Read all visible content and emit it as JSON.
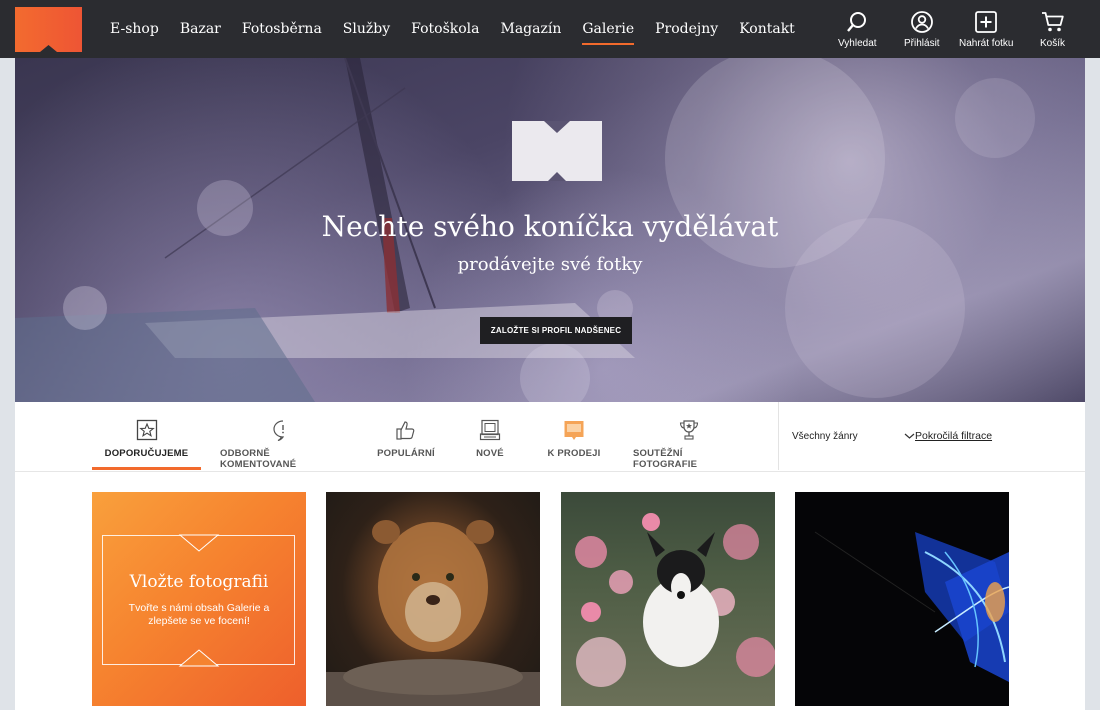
{
  "nav": {
    "links": [
      "E-shop",
      "Bazar",
      "Fotosběrna",
      "Služby",
      "Fotoškola",
      "Magazín",
      "Galerie",
      "Prodejny",
      "Kontakt"
    ],
    "active": "Galerie",
    "tools": {
      "search": "Vyhledat",
      "login": "Přihlásit",
      "upload": "Nahrát fotku",
      "cart": "Košík"
    }
  },
  "hero": {
    "title": "Nechte svého koníčka vydělávat",
    "subtitle": "prodávejte své fotky",
    "button": "ZALOŽTE SI PROFIL NADŠENEC"
  },
  "tabs": [
    {
      "label": "DOPORUČUJEME",
      "icon": "star-icon"
    },
    {
      "label": "ODBORNĚ KOMENTOVANÉ",
      "icon": "comment-icon"
    },
    {
      "label": "POPULÁRNÍ",
      "icon": "thumbs-up-icon"
    },
    {
      "label": "NOVÉ",
      "icon": "new-photo-icon"
    },
    {
      "label": "K PRODEJI",
      "icon": "for-sale-icon"
    },
    {
      "label": "SOUTĚŽNÍ FOTOGRAFIE",
      "icon": "trophy-icon"
    }
  ],
  "filters": {
    "genre": "Všechny žánry",
    "advanced": "Pokročilá filtrace"
  },
  "promo": {
    "title": "Vložte fotografii",
    "text": "Tvořte s námi obsah Galerie a zlepšete se ve focení!"
  },
  "colors": {
    "accent": "#f26a2c",
    "nav_bg": "#2b2c30",
    "button_bg": "#1f1f22"
  }
}
